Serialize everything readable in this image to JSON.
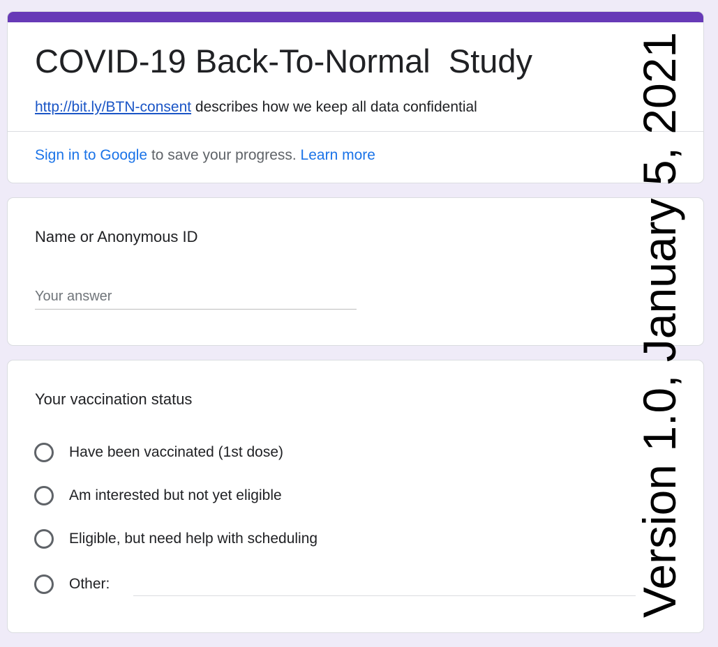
{
  "colors": {
    "page_background": "#efebf8",
    "header_accent": "#673ab7",
    "link": "#1a73e8"
  },
  "form": {
    "title": "COVID-19 Back-To-Normal  Study",
    "description_link": "http://bit.ly/BTN-consent",
    "description_text": " describes how we keep all data confidential",
    "signin_link": "Sign in to Google",
    "signin_text": " to save your progress. ",
    "learn_more": "Learn more"
  },
  "questions": [
    {
      "title": "Name or Anonymous ID",
      "type": "short-answer",
      "placeholder": "Your answer",
      "value": ""
    },
    {
      "title": "Your vaccination status",
      "type": "multiple-choice",
      "options": [
        "Have been vaccinated (1st dose)",
        "Am interested but not yet eligible",
        "Eligible, but need help with scheduling",
        "Other:"
      ],
      "other_value": ""
    }
  ],
  "version_stamp": "Version 1.0, January 5, 2021"
}
